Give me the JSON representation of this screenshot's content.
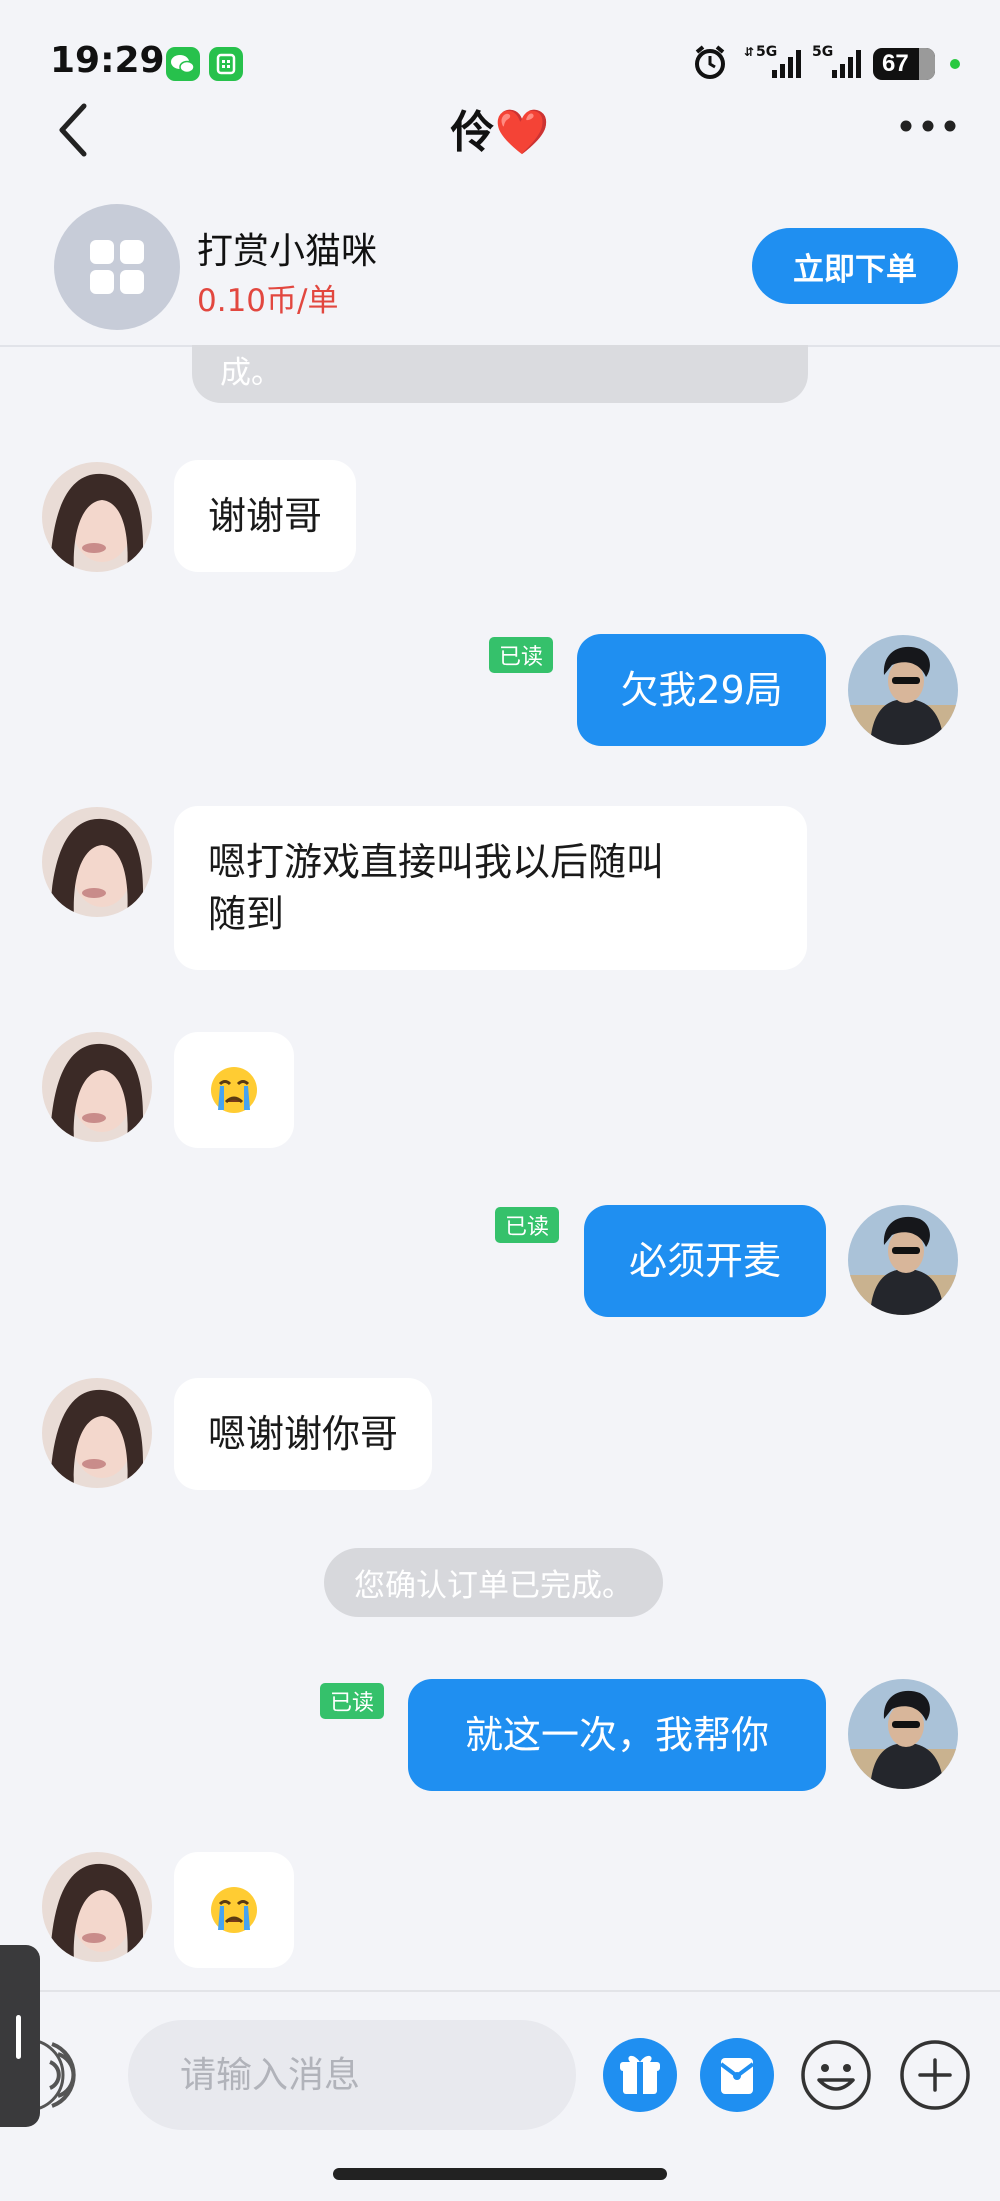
{
  "status_bar": {
    "time": "19:29",
    "battery": "67",
    "network_1": "5G",
    "network_2": "5G"
  },
  "header": {
    "title": "伶❤️"
  },
  "service": {
    "name": "打赏小猫咪",
    "price": "0.10币/单",
    "order_label": "立即下单"
  },
  "messages": {
    "clipped_system_text": "成。",
    "m1": "谢谢哥",
    "m2": "欠我29局",
    "m3_line1": "嗯打游戏直接叫我以后随叫",
    "m3_line2": "随到",
    "m4_emoji": "😭",
    "m5": "必须开麦",
    "m6": "嗯谢谢你哥",
    "system_notice": "您确认订单已完成。",
    "m7": "就这一次，我帮你",
    "m8_emoji": "😭",
    "read_label": "已读"
  },
  "input": {
    "placeholder": "请输入消息"
  },
  "colors": {
    "accent": "#1f8ff1",
    "read_badge": "#35c16b",
    "price": "#e2473f",
    "background": "#f3f4f8"
  },
  "icons": [
    "back-icon",
    "more-icon",
    "grid-icon",
    "voice-icon",
    "gift-icon",
    "red-packet-icon",
    "emoji-icon",
    "plus-icon",
    "alarm-icon",
    "wechat-icon"
  ]
}
